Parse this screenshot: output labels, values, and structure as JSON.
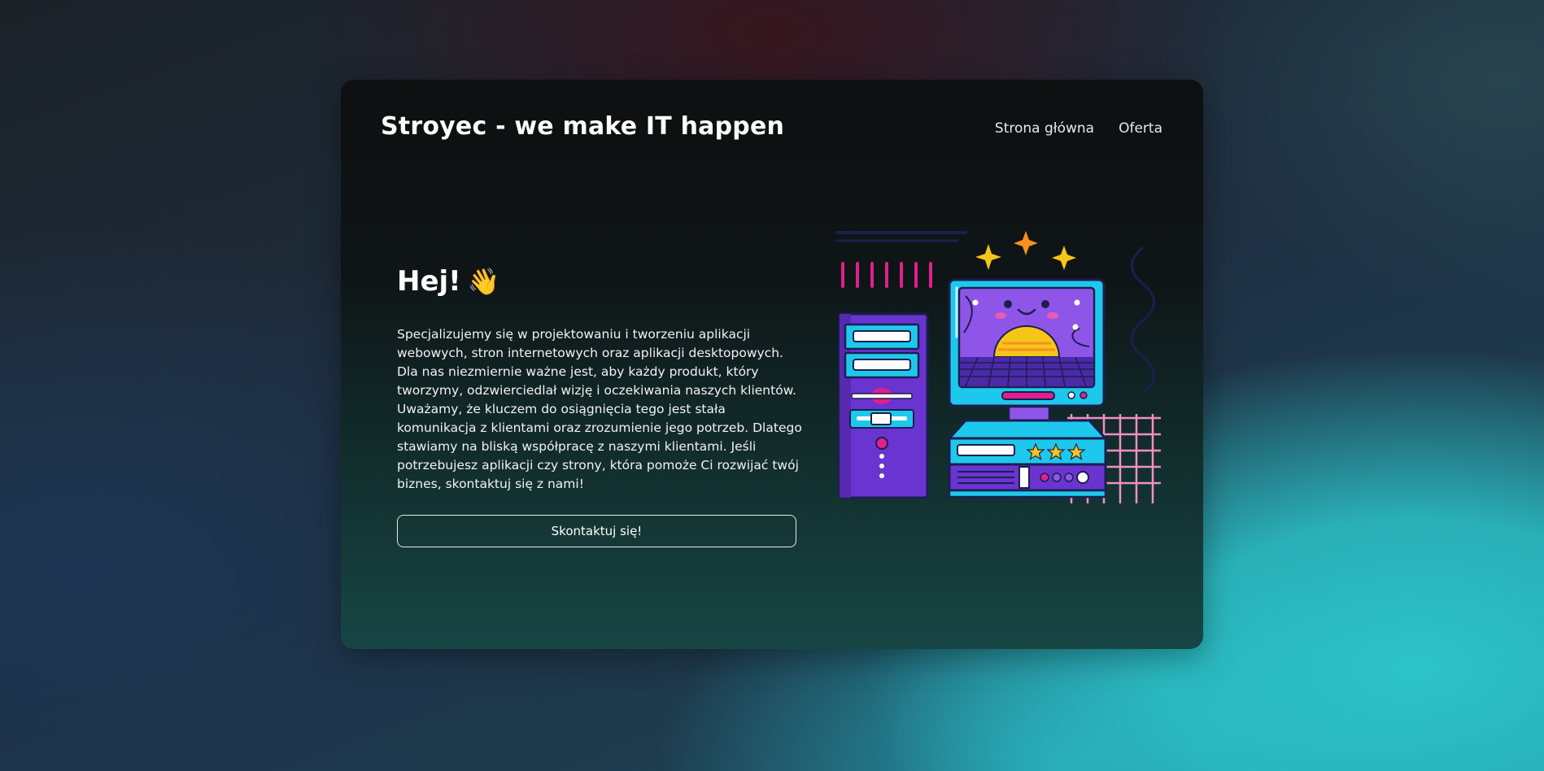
{
  "header": {
    "brand": "Stroyec - we make IT happen",
    "nav": [
      {
        "label": "Strona główna"
      },
      {
        "label": "Oferta"
      }
    ]
  },
  "hero": {
    "greeting": "Hej!",
    "wave_emoji": "👋",
    "description": "Specjalizujemy się w projektowaniu i tworzeniu aplikacji webowych, stron internetowych oraz aplikacji desktopowych. Dla nas niezmiernie ważne jest, aby każdy produkt, który tworzymy, odzwierciedlał wizję i oczekiwania naszych klientów. Uważamy, że kluczem do osiągnięcia tego jest stała komunikacja z klientami oraz zrozumienie jego potrzeb. Dlatego stawiamy na bliską współpracę z naszymi klientami. Jeśli potrzebujesz aplikacji czy strony, która pomoże Ci rozwijać twój biznes, skontaktuj się z nami!",
    "cta_label": "Skontaktuj się!"
  },
  "illustration": {
    "name": "retro-computer-illustration",
    "colors": {
      "cyan": "#1ec8ec",
      "purple": "#6a34d0",
      "magenta": "#e0208c",
      "yellow": "#f5c518",
      "orange": "#f5921e",
      "pink_grid": "#f28fc3",
      "navy": "#1a1f4e"
    }
  }
}
